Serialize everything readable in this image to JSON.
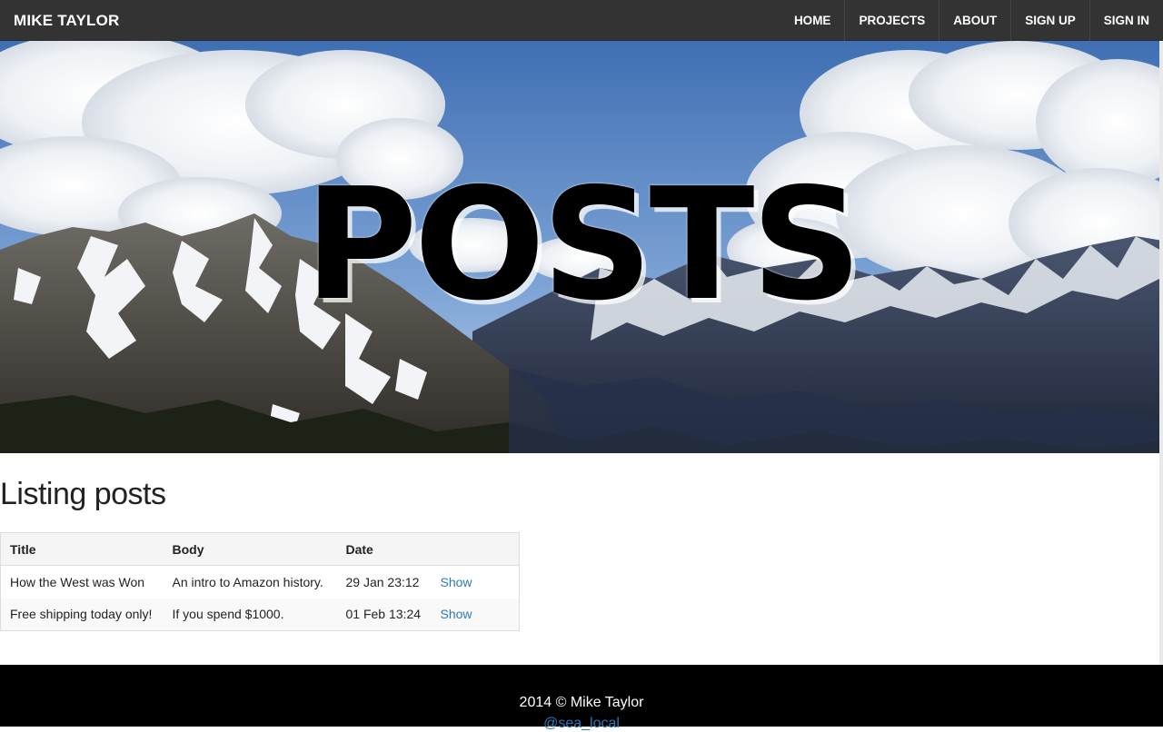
{
  "navbar": {
    "brand": "MIKE TAYLOR",
    "links": [
      "HOME",
      "PROJECTS",
      "ABOUT",
      "SIGN UP",
      "SIGN IN"
    ]
  },
  "hero": {
    "title": "POSTS"
  },
  "main": {
    "heading": "Listing posts",
    "table": {
      "headers": [
        "Title",
        "Body",
        "Date",
        ""
      ],
      "rows": [
        {
          "title": "How the West was Won",
          "body": "An intro to Amazon history.",
          "date": "29 Jan 23:12",
          "action": "Show"
        },
        {
          "title": "Free shipping today only!",
          "body": "If you spend $1000.",
          "date": "01 Feb 13:24",
          "action": "Show"
        }
      ]
    }
  },
  "footer": {
    "copyright": "2014 © Mike Taylor",
    "handle": "@sea_local"
  },
  "colors": {
    "navbar_bg": "#333333",
    "link": "#2a7ab8",
    "footer_bg": "#000000"
  }
}
